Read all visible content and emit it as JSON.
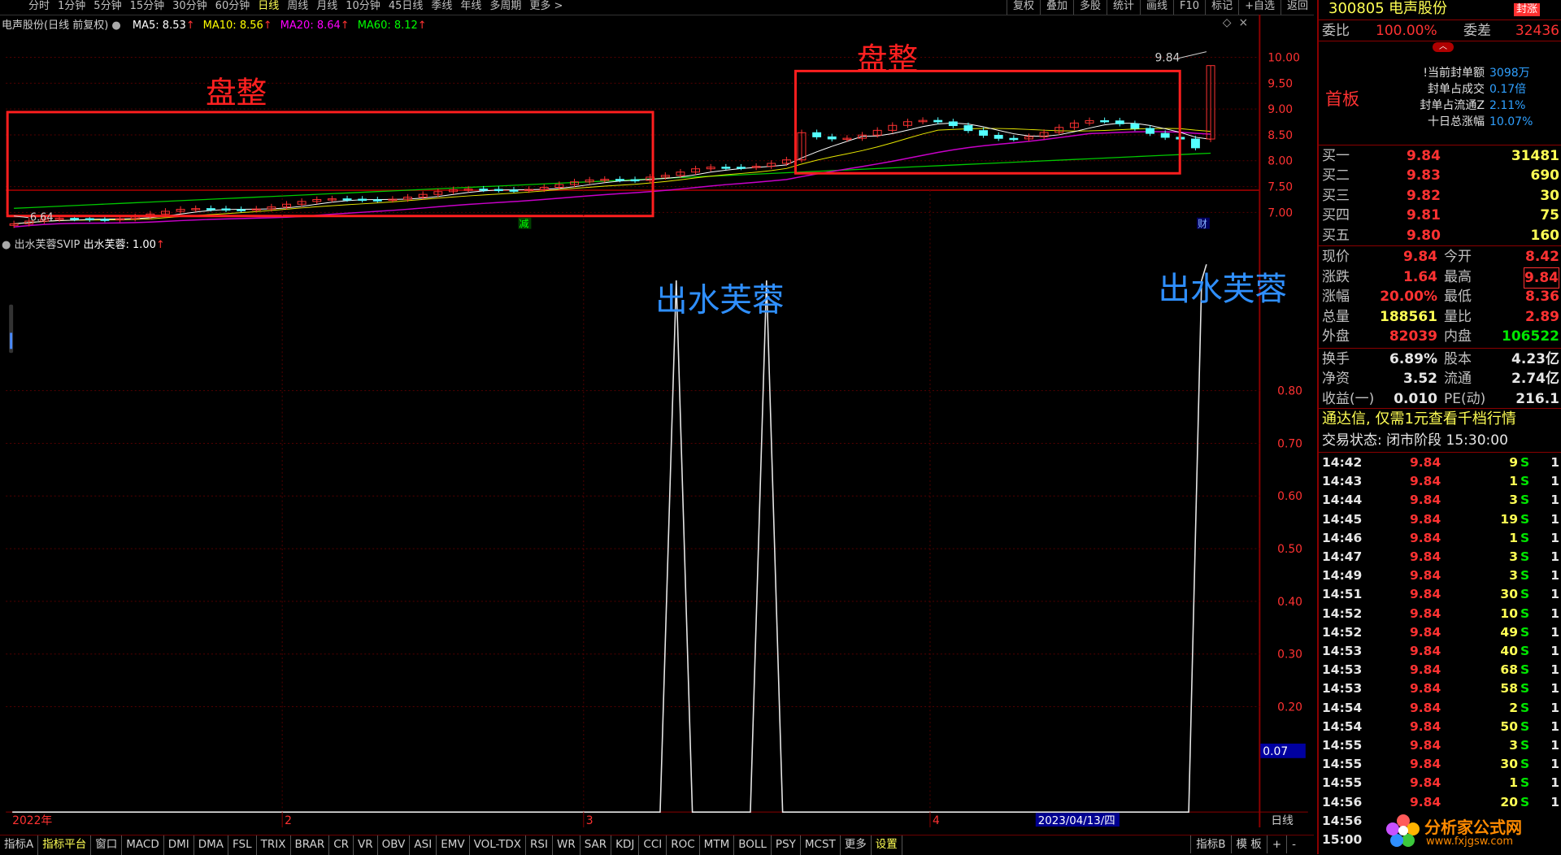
{
  "menu": {
    "periods": [
      "分时",
      "1分钟",
      "5分钟",
      "15分钟",
      "30分钟",
      "60分钟",
      "日线",
      "周线",
      "月线",
      "10分钟",
      "45日线",
      "季线",
      "年线",
      "多周期",
      "更多 >"
    ],
    "active_period": "日线",
    "tools": [
      "复权",
      "叠加",
      "多股",
      "统计",
      "画线",
      "F10",
      "标记",
      "+自选",
      "返回"
    ]
  },
  "chart": {
    "title": "电声股份(日线 前复权)",
    "ma": [
      {
        "label": "MA5: 8.53",
        "color": "#ffffff"
      },
      {
        "label": "MA10: 8.56",
        "color": "#ffff00"
      },
      {
        "label": "MA20: 8.64",
        "color": "#ff00ff"
      },
      {
        "label": "MA60: 8.12",
        "color": "#00ff00"
      }
    ],
    "price_axis": [
      "10.00",
      "9.50",
      "9.00",
      "8.50",
      "8.00",
      "7.50",
      "7.00"
    ],
    "high_label": "9.84",
    "low_label": "6.64",
    "annotation_left": "盘整",
    "annotation_right": "盘整",
    "badge_reduce": "减",
    "badge_finance": "财",
    "indicator_title": "出水芙蓉SVIP",
    "indicator_value": "出水芙蓉: 1.00",
    "indicator_axis": [
      "0.80",
      "0.70",
      "0.60",
      "0.50",
      "0.40",
      "0.30",
      "0.20"
    ],
    "indicator_current": "0.07",
    "signal_label_1": "出水芙蓉",
    "signal_label_2": "出水芙蓉",
    "x_labels": [
      "2022年",
      "2",
      "3",
      "4"
    ],
    "date_cursor": "2023/04/13/四",
    "period_tag": "日线"
  },
  "bottom_tabs": [
    "指标A",
    "指标平台",
    "窗口",
    "MACD",
    "DMI",
    "DMA",
    "FSL",
    "TRIX",
    "BRAR",
    "CR",
    "VR",
    "OBV",
    "ASI",
    "EMV",
    "VOL-TDX",
    "RSI",
    "WR",
    "SAR",
    "KDJ",
    "CCI",
    "ROC",
    "MTM",
    "BOLL",
    "PSY",
    "MCST",
    "更多",
    "设置"
  ],
  "bottom_right_tabs": [
    "指标B",
    "模 板",
    "+",
    "-"
  ],
  "side": {
    "code": "300805",
    "name": "电声股份",
    "seal_badge": "封涨",
    "weibi_label": "委比",
    "weibi_value": "100.00%",
    "weicha_label": "委差",
    "weicha_value": "32436",
    "board": "首板",
    "seal_info": [
      {
        "label": "!当前封单额",
        "value": "3098万"
      },
      {
        "label": "封单占成交",
        "value": "0.17倍"
      },
      {
        "label": "封单占流通Z",
        "value": "2.11%"
      },
      {
        "label": "十日总涨幅",
        "value": "10.07%"
      }
    ],
    "bids": [
      {
        "label": "买一",
        "price": "9.84",
        "vol": "31481"
      },
      {
        "label": "买二",
        "price": "9.83",
        "vol": "690"
      },
      {
        "label": "买三",
        "price": "9.82",
        "vol": "30"
      },
      {
        "label": "买四",
        "price": "9.81",
        "vol": "75"
      },
      {
        "label": "买五",
        "price": "9.80",
        "vol": "160"
      }
    ],
    "quote": [
      {
        "l1": "现价",
        "v1": "9.84",
        "c1": "red",
        "l2": "今开",
        "v2": "8.42",
        "c2": "red"
      },
      {
        "l1": "涨跌",
        "v1": "1.64",
        "c1": "red",
        "l2": "最高",
        "v2": "9.84",
        "c2": "red"
      },
      {
        "l1": "涨幅",
        "v1": "20.00%",
        "c1": "red",
        "l2": "最低",
        "v2": "8.36",
        "c2": "red"
      },
      {
        "l1": "总量",
        "v1": "188561",
        "c1": "yellow",
        "l2": "量比",
        "v2": "2.89",
        "c2": "red"
      },
      {
        "l1": "外盘",
        "v1": "82039",
        "c1": "red",
        "l2": "内盘",
        "v2": "106522",
        "c2": "green"
      }
    ],
    "fundamentals": [
      {
        "l1": "换手",
        "v1": "6.89%",
        "l2": "股本",
        "v2": "4.23亿"
      },
      {
        "l1": "净资",
        "v1": "3.52",
        "l2": "流通",
        "v2": "2.74亿"
      },
      {
        "l1": "收益(一)",
        "v1": "0.010",
        "l2": "PE(动)",
        "v2": "216.1"
      }
    ],
    "promo": "通达信, 仅需1元查看千档行情",
    "status": "交易状态: 闭市阶段 15:30:00",
    "ticks": [
      {
        "t": "14:42",
        "p": "9.84",
        "q": "9",
        "s": "S",
        "n": "1"
      },
      {
        "t": "14:43",
        "p": "9.84",
        "q": "1",
        "s": "S",
        "n": "1"
      },
      {
        "t": "14:44",
        "p": "9.84",
        "q": "3",
        "s": "S",
        "n": "1"
      },
      {
        "t": "14:45",
        "p": "9.84",
        "q": "19",
        "s": "S",
        "n": "1"
      },
      {
        "t": "14:46",
        "p": "9.84",
        "q": "1",
        "s": "S",
        "n": "1"
      },
      {
        "t": "14:47",
        "p": "9.84",
        "q": "3",
        "s": "S",
        "n": "1"
      },
      {
        "t": "14:49",
        "p": "9.84",
        "q": "3",
        "s": "S",
        "n": "1"
      },
      {
        "t": "14:51",
        "p": "9.84",
        "q": "30",
        "s": "S",
        "n": "1"
      },
      {
        "t": "14:52",
        "p": "9.84",
        "q": "10",
        "s": "S",
        "n": "1"
      },
      {
        "t": "14:52",
        "p": "9.84",
        "q": "49",
        "s": "S",
        "n": "1"
      },
      {
        "t": "14:53",
        "p": "9.84",
        "q": "40",
        "s": "S",
        "n": "1"
      },
      {
        "t": "14:53",
        "p": "9.84",
        "q": "68",
        "s": "S",
        "n": "1"
      },
      {
        "t": "14:53",
        "p": "9.84",
        "q": "58",
        "s": "S",
        "n": "1"
      },
      {
        "t": "14:54",
        "p": "9.84",
        "q": "2",
        "s": "S",
        "n": "1"
      },
      {
        "t": "14:54",
        "p": "9.84",
        "q": "50",
        "s": "S",
        "n": "1"
      },
      {
        "t": "14:55",
        "p": "9.84",
        "q": "3",
        "s": "S",
        "n": "1"
      },
      {
        "t": "14:55",
        "p": "9.84",
        "q": "30",
        "s": "S",
        "n": "1"
      },
      {
        "t": "14:55",
        "p": "9.84",
        "q": "1",
        "s": "S",
        "n": "1"
      },
      {
        "t": "14:56",
        "p": "9.84",
        "q": "20",
        "s": "S",
        "n": "1"
      },
      {
        "t": "14:56",
        "p": "",
        "q": "",
        "s": "",
        "n": ""
      },
      {
        "t": "15:00",
        "p": "",
        "q": "",
        "s": "",
        "n": ""
      }
    ],
    "watermark": "分析家公式网",
    "watermark_url": "www.fxjgsw.com"
  }
}
